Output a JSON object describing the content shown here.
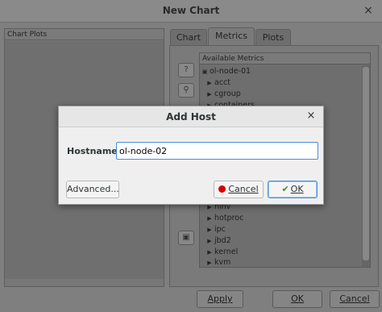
{
  "window": {
    "title": "New Chart",
    "close_glyph": "×"
  },
  "left_panel": {
    "header": "Chart Plots"
  },
  "tabs": [
    {
      "label": "Chart",
      "active": false
    },
    {
      "label": "Metrics",
      "active": true
    },
    {
      "label": "Plots",
      "active": false
    }
  ],
  "side_buttons": [
    {
      "icon": "help-icon"
    },
    {
      "icon": "search-icon"
    },
    {
      "icon": "host-icon"
    }
  ],
  "metrics": {
    "header": "Available Metrics",
    "items": [
      {
        "label": "ol-node-01",
        "kind": "host"
      },
      {
        "label": "acct",
        "kind": "group"
      },
      {
        "label": "cgroup",
        "kind": "group"
      },
      {
        "label": "containers",
        "kind": "group"
      },
      {
        "label": "hinv",
        "kind": "group"
      },
      {
        "label": "hotproc",
        "kind": "group"
      },
      {
        "label": "ipc",
        "kind": "group"
      },
      {
        "label": "jbd2",
        "kind": "group"
      },
      {
        "label": "kernel",
        "kind": "group"
      },
      {
        "label": "kvm",
        "kind": "group"
      }
    ]
  },
  "bottom_buttons": {
    "apply": "Apply",
    "ok": "OK",
    "cancel": "Cancel"
  },
  "dialog": {
    "title": "Add Host",
    "close_glyph": "×",
    "hostname_label": "Hostname:",
    "hostname_value": "ol-node-02",
    "advanced_label": "Advanced...",
    "cancel_label": "Cancel",
    "ok_label": "OK"
  }
}
